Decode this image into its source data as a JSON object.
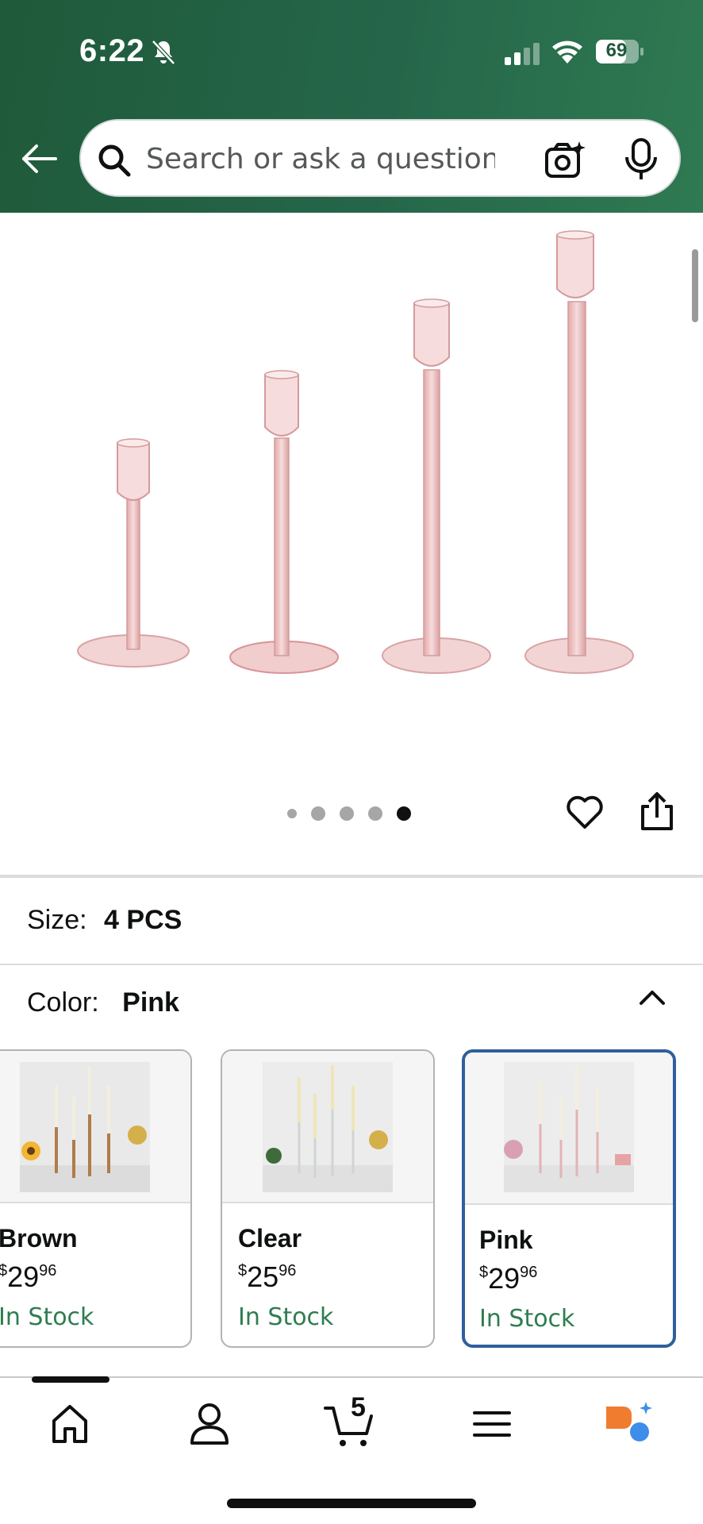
{
  "status_bar": {
    "time": "6:22",
    "battery": "69"
  },
  "header": {
    "search_placeholder": "Search or ask a question"
  },
  "carousel": {
    "image_count": 5,
    "active_index": 4
  },
  "product": {
    "size_label": "Size:",
    "size_value": "4 PCS",
    "color_label": "Color:",
    "color_value": "Pink"
  },
  "color_options": [
    {
      "name": "Brown",
      "price_currency": "$",
      "price_whole": "29",
      "price_fraction": "96",
      "stock": "In Stock",
      "selected": false
    },
    {
      "name": "Clear",
      "price_currency": "$",
      "price_whole": "25",
      "price_fraction": "96",
      "stock": "In Stock",
      "selected": false
    },
    {
      "name": "Pink",
      "price_currency": "$",
      "price_whole": "29",
      "price_fraction": "96",
      "stock": "In Stock",
      "selected": true
    }
  ],
  "bottom_nav": {
    "cart_count": "5",
    "items": [
      "home-icon",
      "account-icon",
      "cart-icon",
      "menu-icon",
      "rufus-icon"
    ]
  },
  "colors": {
    "header_green": "#25664a",
    "selected_border": "#2f5f9c",
    "stock_green": "#2e7d4f"
  }
}
